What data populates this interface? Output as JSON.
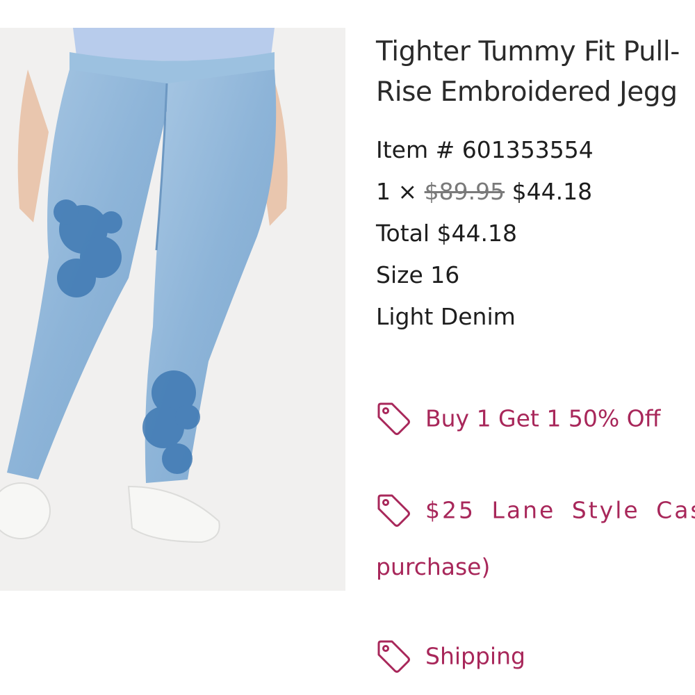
{
  "product": {
    "title_line1": "Tighter Tummy Fit Pull-",
    "title_line2": "Rise Embroidered Jegg",
    "item_number": "Item # 601353554",
    "quantity_prefix": "1 ×",
    "original_price": "$89.95",
    "sale_price": "$44.18",
    "total": "Total $44.18",
    "size": "Size 16",
    "color": "Light Denim"
  },
  "promotions": [
    {
      "label": "Buy 1 Get 1 50% Off",
      "icon": "price-tag-icon"
    },
    {
      "label": "$25 Lane Style Cas",
      "continuation": "purchase)",
      "icon": "price-tag-icon"
    },
    {
      "label": "Shipping",
      "icon": "price-tag-icon"
    }
  ],
  "colors": {
    "promo": "#a8275a",
    "denim": "#8fb6d8",
    "embroidery": "#3f79b3"
  }
}
